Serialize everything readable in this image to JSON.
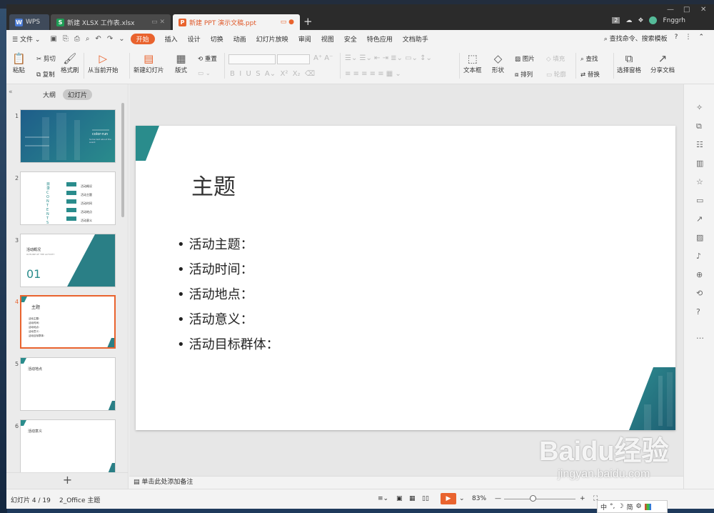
{
  "tabs": [
    {
      "label": "WPS"
    },
    {
      "label": "新建 XLSX 工作表.xlsx"
    },
    {
      "label": "新建 PPT 演示文稿.ppt"
    }
  ],
  "user": {
    "name": "Fnggrh",
    "badge": "2"
  },
  "menu": {
    "file": "文件",
    "items": [
      "开始",
      "插入",
      "设计",
      "切换",
      "动画",
      "幻灯片放映",
      "审阅",
      "视图",
      "安全",
      "特色应用",
      "文档助手"
    ],
    "search": "查找命令、搜索模板"
  },
  "ribbon": {
    "paste": "粘贴",
    "cut": "剪切",
    "copy": "复制",
    "format_painter": "格式刷",
    "play_from_current": "从当前开始",
    "new_slide": "新建幻灯片",
    "layout": "版式",
    "reset": "重置",
    "textbox": "文本框",
    "shape": "形状",
    "picture": "图片",
    "fill": "填充",
    "arrange": "排列",
    "outline": "轮廓",
    "find": "查找",
    "replace": "替换",
    "selection_pane": "选择窗格",
    "share_doc": "分享文档"
  },
  "panel": {
    "tab_outline": "大纲",
    "tab_slides": "幻灯片",
    "thumbs": [
      {
        "num": "1",
        "line1": "color-run",
        "line2": "Some text about the event"
      },
      {
        "num": "2",
        "title": "目录CONTENTS",
        "items": [
          "活动概况",
          "活动主题",
          "活动时间",
          "活动地点",
          "活动意义"
        ]
      },
      {
        "num": "3",
        "title": "活动概况",
        "sub": "OUTLINE OF THE ACTIVITY",
        "big": "01"
      },
      {
        "num": "4",
        "title": "主题",
        "items": [
          "活动主题：",
          "活动时间：",
          "活动地点：",
          "活动意义：",
          "活动目标群体："
        ]
      },
      {
        "num": "5",
        "title": "活动地点"
      },
      {
        "num": "6",
        "title": "活动意义"
      }
    ]
  },
  "slide": {
    "title": "主题",
    "bullets": [
      "活动主题：",
      "活动时间：",
      "活动地点：",
      "活动意义：",
      "活动目标群体："
    ],
    "accent": "#2a8c8c"
  },
  "notes": {
    "placeholder": "单击此处添加备注"
  },
  "status": {
    "slide_count": "幻灯片 4 / 19",
    "theme": "2_Office 主题",
    "zoom": "83%"
  },
  "watermark": {
    "line1": "Baidu经验",
    "line2": "jingyan.baidu.com"
  },
  "tray": {
    "ime": "中",
    "simple": "简"
  }
}
